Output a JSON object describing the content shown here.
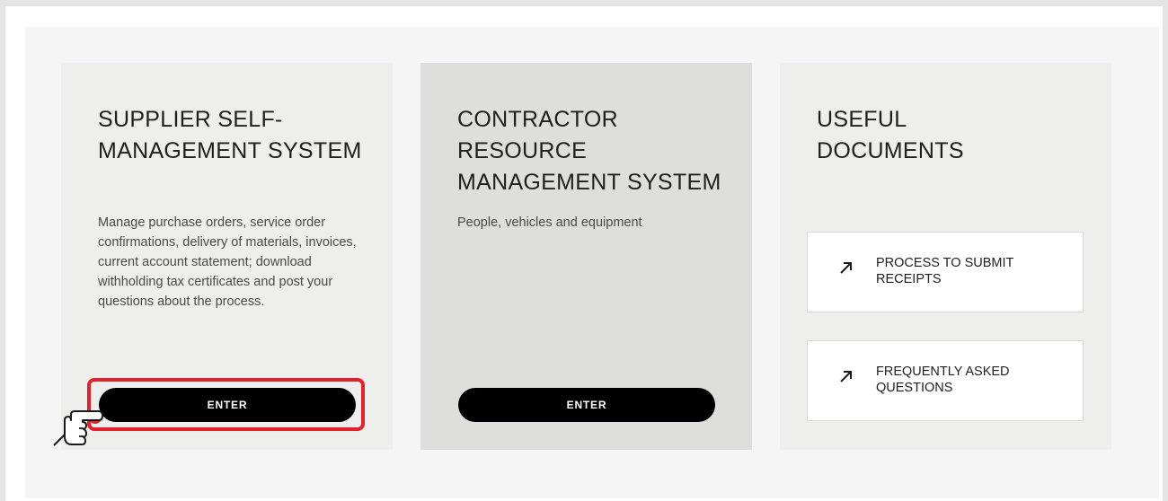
{
  "supplier_card": {
    "title": "SUPPLIER SELF-MANAGEMENT SYSTEM",
    "description": "Manage purchase orders, service order confirmations, delivery of materials, invoices, current account statement; download withholding tax certificates and post your questions about the process.",
    "button_label": "ENTER"
  },
  "contractor_card": {
    "title": "CONTRACTOR RESOURCE MANAGEMENT SYSTEM",
    "description": "People, vehicles and equipment",
    "button_label": "ENTER"
  },
  "documents_card": {
    "title": "USEFUL DOCUMENTS",
    "links": [
      {
        "label": "PROCESS TO SUBMIT RECEIPTS",
        "icon": "arrow-up-right-icon"
      },
      {
        "label": "FREQUENTLY ASKED QUESTIONS",
        "icon": "arrow-up-right-icon"
      }
    ]
  },
  "annotation": {
    "highlight_color": "#e4202a",
    "pointer_icon": "pointing-hand-icon"
  }
}
